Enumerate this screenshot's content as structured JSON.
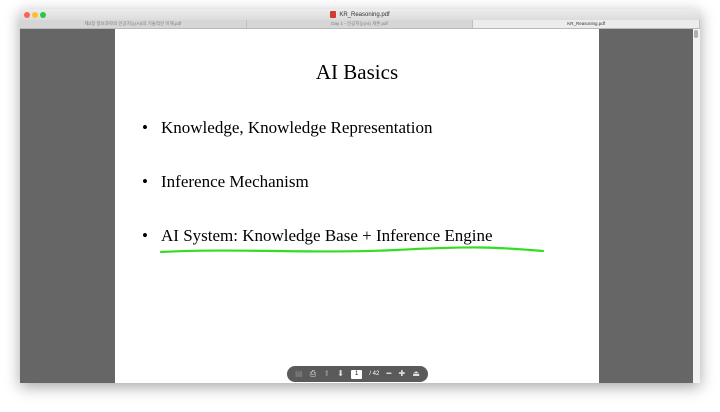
{
  "window": {
    "title": "KR_Reasoning.pdf",
    "tabs": [
      {
        "label": "제2장 정보과학의 인공지능(AI)의 기술적인 이해.pdf"
      },
      {
        "label": "Day 1 - 인공지능(AI) 개론.pdf"
      },
      {
        "label": "KR_Reasoning.pdf"
      }
    ]
  },
  "slide": {
    "title": "AI Basics",
    "bullets": [
      {
        "marker": "•",
        "text": "Knowledge,  Knowledge Representation"
      },
      {
        "marker": "•",
        "text": "Inference Mechanism"
      },
      {
        "marker": "•",
        "text": "AI System:  Knowledge Base + Inference Engine"
      }
    ],
    "highlight_color": "#33dd22"
  },
  "toolbar": {
    "current_page": "1",
    "total_pages": "/ 42",
    "icons": [
      "sidebar-icon",
      "print-icon",
      "up-arrow-icon",
      "down-arrow-icon",
      "zoom-out-icon",
      "zoom-in-icon",
      "scroll-top-icon"
    ]
  }
}
